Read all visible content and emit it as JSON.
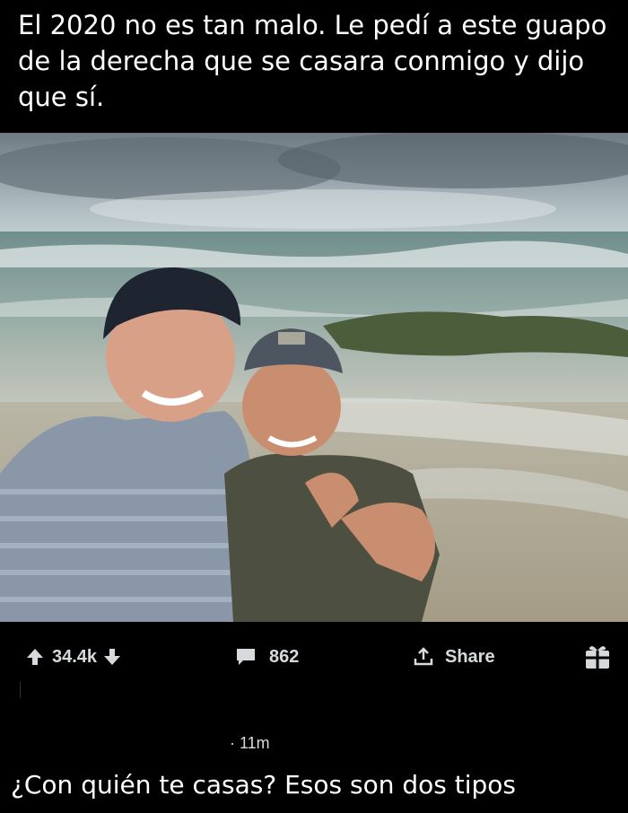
{
  "caption": "El 2020 no es tan malo. Le pedí a este guapo de la derecha que se casara conmigo y dijo que sí.",
  "photo": {
    "icon": "photo-beach-selfie"
  },
  "actions": {
    "upvote_icon": "arrow-up-icon",
    "votes": "34.4k",
    "downvote_icon": "arrow-down-icon",
    "comment_icon": "comment-bubble-icon",
    "comments": "862",
    "share_icon": "share-upload-icon",
    "share_label": "Share",
    "award_icon": "gift-icon"
  },
  "post_time": "· 11m",
  "reply": "¿Con quién te casas? Esos son dos tipos",
  "colors": {
    "background": "#000000",
    "action_text": "#d7dadc",
    "text": "#ffffff"
  }
}
